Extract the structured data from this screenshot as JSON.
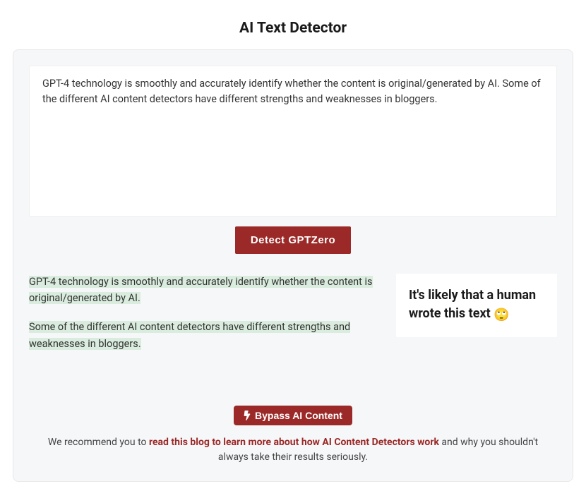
{
  "title": "AI Text Detector",
  "input": {
    "value": "GPT-4 technology is smoothly and accurately identify whether the content is original/generated by AI. Some of the different AI content detectors have different strengths and weaknesses in bloggers."
  },
  "detect_button": "Detect GPTZero",
  "result": {
    "highlighted_sentences": [
      " GPT-4 technology is smoothly and accurately identify whether the content is original/generated by AI. ",
      " Some of the different AI content detectors have different strengths and weaknesses in bloggers. "
    ],
    "verdict": "It's likely that a human wrote this text ",
    "verdict_emoji": "🙄"
  },
  "bypass_button": "Bypass AI Content",
  "recommend": {
    "prefix": "We recommend you to ",
    "link": "read this blog to learn more about how AI Content Detectors work",
    "suffix": " and why you shouldn't always take their results seriously."
  }
}
